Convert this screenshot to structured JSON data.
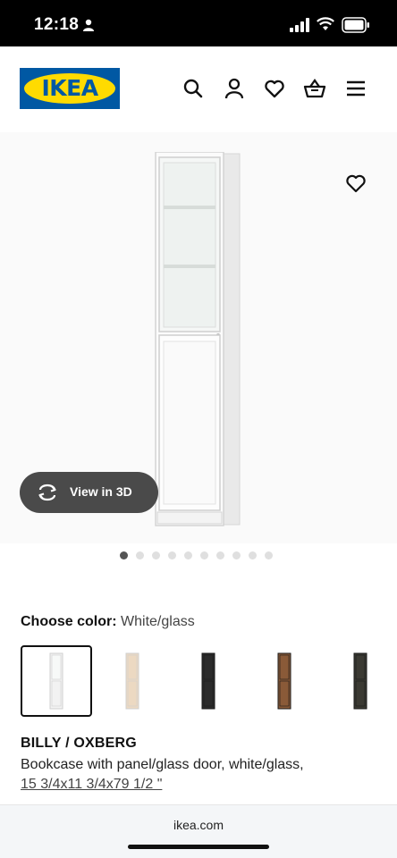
{
  "status_bar": {
    "time": "12:18"
  },
  "header": {
    "logo_text": "IKEA",
    "icons": [
      "search-icon",
      "account-icon",
      "heart-icon",
      "basket-icon",
      "menu-icon"
    ]
  },
  "product_image": {
    "view3d_label": "View in 3D",
    "carousel": {
      "total": 10,
      "active_index": 0
    }
  },
  "color_chooser": {
    "label": "Choose color:",
    "selected_value": "White/glass",
    "swatches": [
      {
        "color": "white/glass",
        "hex": "#f2f2f2",
        "selected": true
      },
      {
        "color": "birch",
        "hex": "#ecd9c2",
        "selected": false
      },
      {
        "color": "black",
        "hex": "#2b2b2b",
        "selected": false
      },
      {
        "color": "brown",
        "hex": "#8a5a38",
        "selected": false
      },
      {
        "color": "dark",
        "hex": "#3b3a33",
        "selected": false
      }
    ]
  },
  "product": {
    "name": "BILLY / OXBERG",
    "description": "Bookcase with panel/glass door, white/glass,",
    "size": "15 3/4x11 3/4x79 1/2 \""
  },
  "browser": {
    "url": "ikea.com"
  },
  "colors": {
    "brand_blue": "#0058a3",
    "brand_yellow": "#ffdb00"
  }
}
